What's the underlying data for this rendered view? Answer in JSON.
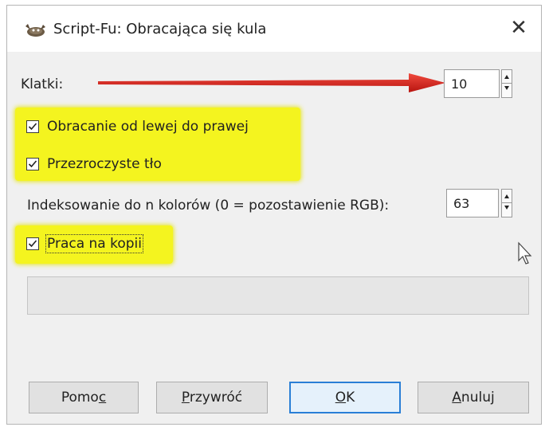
{
  "window": {
    "title": "Script-Fu: Obracająca się kula",
    "close_glyph": "✕"
  },
  "frames": {
    "label": "Klatki:",
    "value": "10"
  },
  "checkboxes": [
    {
      "label": "Obracanie od lewej do prawej",
      "checked": true
    },
    {
      "label": "Przezroczyste tło",
      "checked": true
    }
  ],
  "indexing": {
    "label": "Indeksowanie do n kolorów (0 = pozostawienie RGB):",
    "value": "63"
  },
  "work_on_copy": {
    "label": "Praca na kopii",
    "checked": true
  },
  "progress": {
    "value": 0
  },
  "buttons": {
    "help": {
      "pre": "Pomo",
      "mnemonic": "c",
      "post": ""
    },
    "reset": {
      "pre": "",
      "mnemonic": "P",
      "post": "rzywróć"
    },
    "ok": {
      "pre": "",
      "mnemonic": "O",
      "post": "K"
    },
    "cancel": {
      "pre": "",
      "mnemonic": "A",
      "post": "nuluj"
    }
  },
  "colors": {
    "highlight": "#f4f41f",
    "arrow": "#e0201b",
    "accent": "#2a7fd6"
  },
  "icons": {
    "app": "gimp-wilber-icon",
    "annotation": "red-arrow-icon",
    "cursor": "mouse-pointer-icon"
  }
}
